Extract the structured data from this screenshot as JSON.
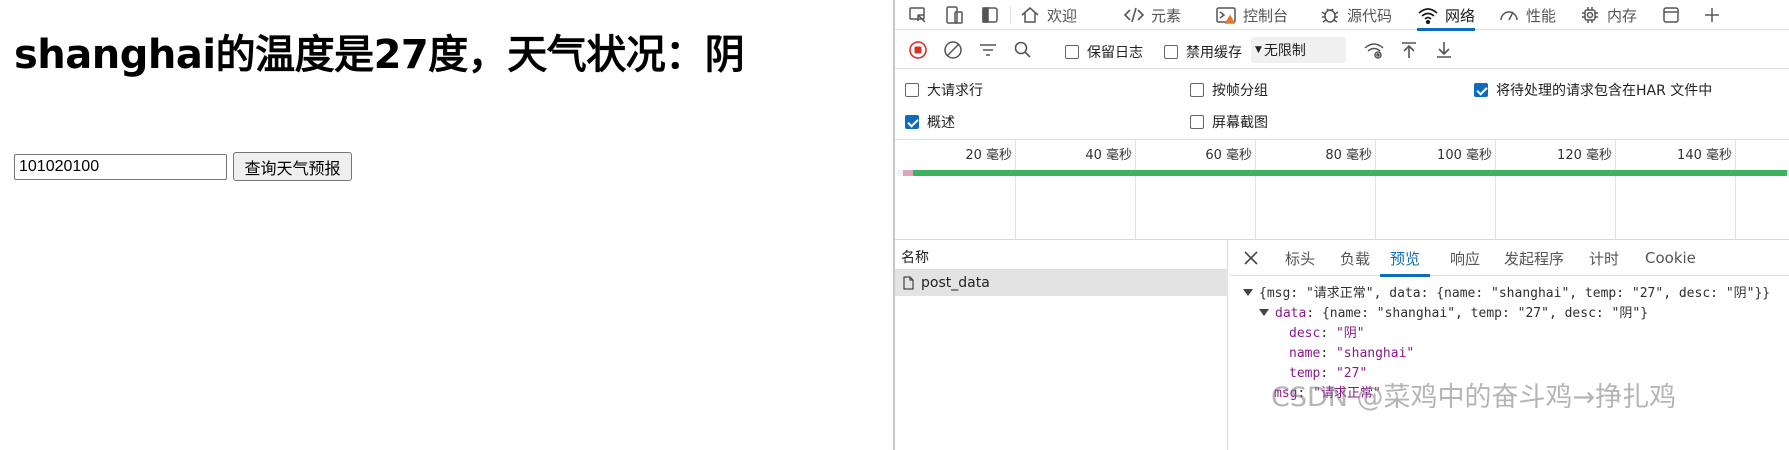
{
  "page": {
    "heading": "shanghai的温度是27度，天气状况：阴",
    "city_code_value": "101020100",
    "query_button": "查询天气预报"
  },
  "devtools": {
    "tabs": [
      {
        "label": "欢迎",
        "icon": "home-icon"
      },
      {
        "label": "元素",
        "icon": "code-brackets-icon"
      },
      {
        "label": "控制台",
        "icon": "console-warning-icon"
      },
      {
        "label": "源代码",
        "icon": "bug-icon"
      },
      {
        "label": "网络",
        "icon": "wifi-icon"
      },
      {
        "label": "性能",
        "icon": "gauge-icon"
      },
      {
        "label": "内存",
        "icon": "cpu-icon"
      }
    ],
    "active_tab": "网络",
    "toolbar": {
      "preserve_log": "保留日志",
      "disable_cache": "禁用缓存",
      "throttle": "无限制"
    },
    "options": {
      "large_rows": "大请求行",
      "group_by_frame": "按帧分组",
      "include_pending_har": "将待处理的请求包含在HAR 文件中",
      "overview": "概述",
      "screenshots": "屏幕截图"
    },
    "timeline_ticks": [
      "20 毫秒",
      "40 毫秒",
      "60 毫秒",
      "80 毫秒",
      "100 毫秒",
      "120 毫秒",
      "140 毫秒"
    ],
    "name_column_header": "名称",
    "request_name": "post_data",
    "detail_tabs": [
      "标头",
      "负载",
      "预览",
      "响应",
      "发起程序",
      "计时",
      "Cookie"
    ],
    "active_detail_tab": "预览",
    "preview": {
      "root_summary": "{msg: \"请求正常\", data: {name: \"shanghai\", temp: \"27\", desc: \"阴\"}}",
      "data_key": "data",
      "data_summary": "{name: \"shanghai\", temp: \"27\", desc: \"阴\"}",
      "desc_key": "desc",
      "desc_val": "\"阴\"",
      "name_key": "name",
      "name_val": "\"shanghai\"",
      "temp_key": "temp",
      "temp_val": "\"27\"",
      "msg_key": "msg",
      "msg_val": "\"请求正常\""
    },
    "watermark": "CSDN @菜鸡中的奋斗鸡→挣扎鸡"
  }
}
